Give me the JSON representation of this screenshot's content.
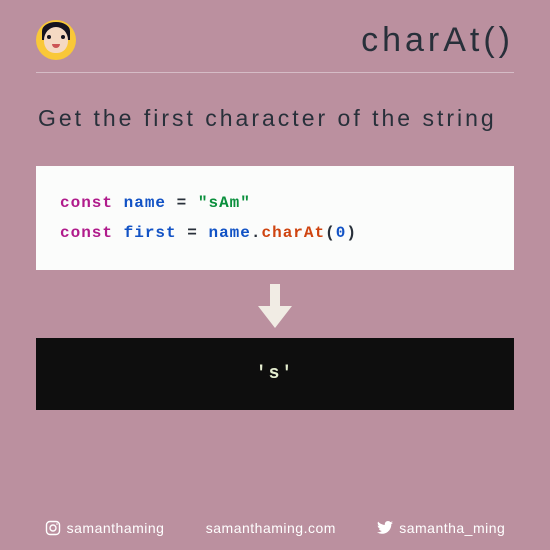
{
  "header": {
    "title": "charAt()"
  },
  "description": "Get the first character of the string",
  "code": {
    "kw1": "const",
    "var1": "name",
    "eq": "=",
    "str": "\"sAm\"",
    "kw2": "const",
    "var2": "first",
    "name_ref": "name",
    "dot": ".",
    "fn": "charAt",
    "lparen": "(",
    "arg": "0",
    "rparen": ")"
  },
  "output": "'s'",
  "footer": {
    "instagram": "samanthaming",
    "website": "samanthaming.com",
    "twitter": "samantha_ming"
  }
}
